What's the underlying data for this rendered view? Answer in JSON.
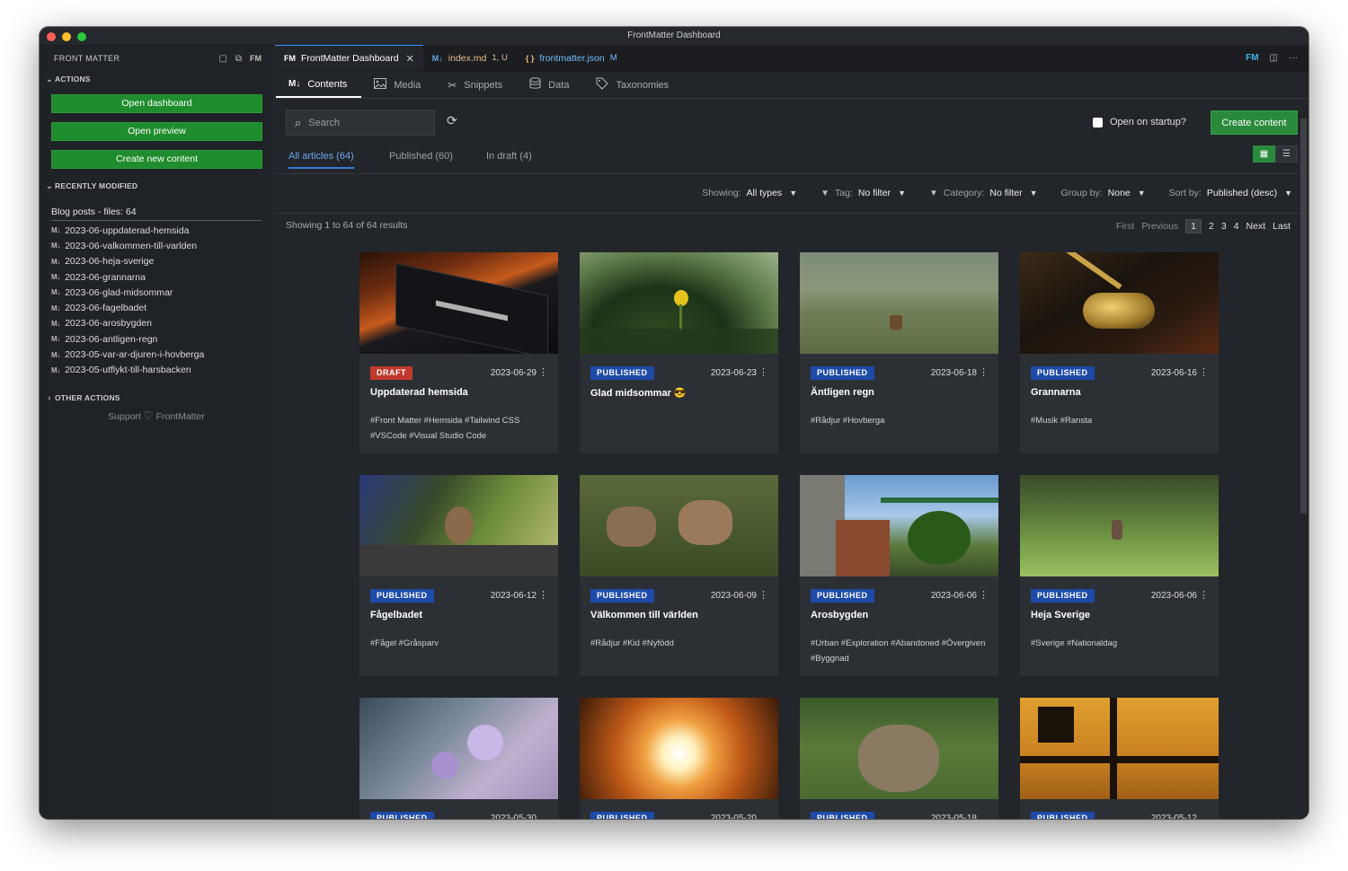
{
  "window": {
    "title": "FrontMatter Dashboard"
  },
  "sidebar": {
    "title": "FRONT MATTER",
    "actions_label": "ACTIONS",
    "buttons": [
      "Open dashboard",
      "Open preview",
      "Create new content"
    ],
    "recent_label": "RECENTLY MODIFIED",
    "recent_group": "Blog posts - files: 64",
    "md_badge": "M↓",
    "recent_files": [
      "2023-06-uppdaterad-hemsida",
      "2023-06-valkommen-till-varlden",
      "2023-06-heja-sverige",
      "2023-06-grannarna",
      "2023-06-glad-midsommar",
      "2023-06-fagelbadet",
      "2023-06-arosbygden",
      "2023-06-antligen-regn",
      "2023-05-var-ar-djuren-i-hovberga",
      "2023-05-utflykt-till-harsbacken"
    ],
    "other_label": "OTHER ACTIONS",
    "support_label": "Support",
    "support_target": "FrontMatter"
  },
  "editor_tabs": [
    {
      "label": "FrontMatter Dashboard",
      "icon": "FM",
      "suffix": ""
    },
    {
      "label": "index.md",
      "icon": "M↓",
      "suffix": "1, U"
    },
    {
      "label": "frontmatter.json",
      "icon": "{ }",
      "suffix": "M"
    }
  ],
  "editor_right_icon": "FM",
  "nav_tabs": [
    {
      "label": "Contents",
      "icon": "M↓"
    },
    {
      "label": "Media",
      "icon": "image-icon"
    },
    {
      "label": "Snippets",
      "icon": "scissors-icon"
    },
    {
      "label": "Data",
      "icon": "database-icon"
    },
    {
      "label": "Taxonomies",
      "icon": "tag-icon"
    }
  ],
  "toolbar": {
    "search_placeholder": "Search",
    "startup_label": "Open on startup?",
    "create_label": "Create content"
  },
  "status_tabs": [
    "All articles (64)",
    "Published (60)",
    "In draft (4)"
  ],
  "filters": {
    "showing_label": "Showing:",
    "showing_value": "All types",
    "tag_label": "Tag:",
    "tag_value": "No filter",
    "category_label": "Category:",
    "category_value": "No filter",
    "group_label": "Group by:",
    "group_value": "None",
    "sort_label": "Sort by:",
    "sort_value": "Published (desc)"
  },
  "results_text": "Showing 1 to 64 of 64 results",
  "pagination": {
    "first": "First",
    "previous": "Previous",
    "pages": [
      "1",
      "2",
      "3",
      "4"
    ],
    "next": "Next",
    "last": "Last"
  },
  "colors": {
    "accent_green": "#2a8a3c",
    "draft_red": "#c0392b",
    "published_blue": "#1e4aa8",
    "active_link": "#6aa7ee"
  },
  "cards": [
    {
      "status": "DRAFT",
      "date": "2023-06-29",
      "title": "Uppdaterad hemsida",
      "tags": "#Front Matter #Hemsida #Tailwind CSS #VSCode #Visual Studio Code",
      "image": "phone-screen"
    },
    {
      "status": "PUBLISHED",
      "date": "2023-06-23",
      "title": "Glad midsommar 😎",
      "tags": "",
      "image": "water-lily"
    },
    {
      "status": "PUBLISHED",
      "date": "2023-06-18",
      "title": "Äntligen regn",
      "tags": "#Rådjur #Hovberga",
      "image": "deer-in-meadow"
    },
    {
      "status": "PUBLISHED",
      "date": "2023-06-16",
      "title": "Grannarna",
      "tags": "#Musik #Ransta",
      "image": "gold-instrument"
    },
    {
      "status": "PUBLISHED",
      "date": "2023-06-12",
      "title": "Fågelbadet",
      "tags": "#Fågel #Gråsparv",
      "image": "sparrow-birdbath"
    },
    {
      "status": "PUBLISHED",
      "date": "2023-06-09",
      "title": "Välkommen till världen",
      "tags": "#Rådjur #Kid #Nyfödd",
      "image": "fawns"
    },
    {
      "status": "PUBLISHED",
      "date": "2023-06-06",
      "title": "Arosbygden",
      "tags": "#Urban #Exploration #Abandoned #Övergiven #Byggnad",
      "image": "industrial-site"
    },
    {
      "status": "PUBLISHED",
      "date": "2023-06-06",
      "title": "Heja Sverige",
      "tags": "#Sverige #Nationaldag",
      "image": "hare-in-field"
    },
    {
      "status": "PUBLISHED",
      "date": "2023-05-30",
      "title": "",
      "tags": "",
      "image": "lilac-flowers"
    },
    {
      "status": "PUBLISHED",
      "date": "2023-05-20",
      "title": "",
      "tags": "",
      "image": "sunset-branches"
    },
    {
      "status": "PUBLISHED",
      "date": "2023-05-18",
      "title": "",
      "tags": "",
      "image": "hare-portrait"
    },
    {
      "status": "PUBLISHED",
      "date": "2023-05-12",
      "title": "",
      "tags": "",
      "image": "silhouette-sunset"
    }
  ]
}
